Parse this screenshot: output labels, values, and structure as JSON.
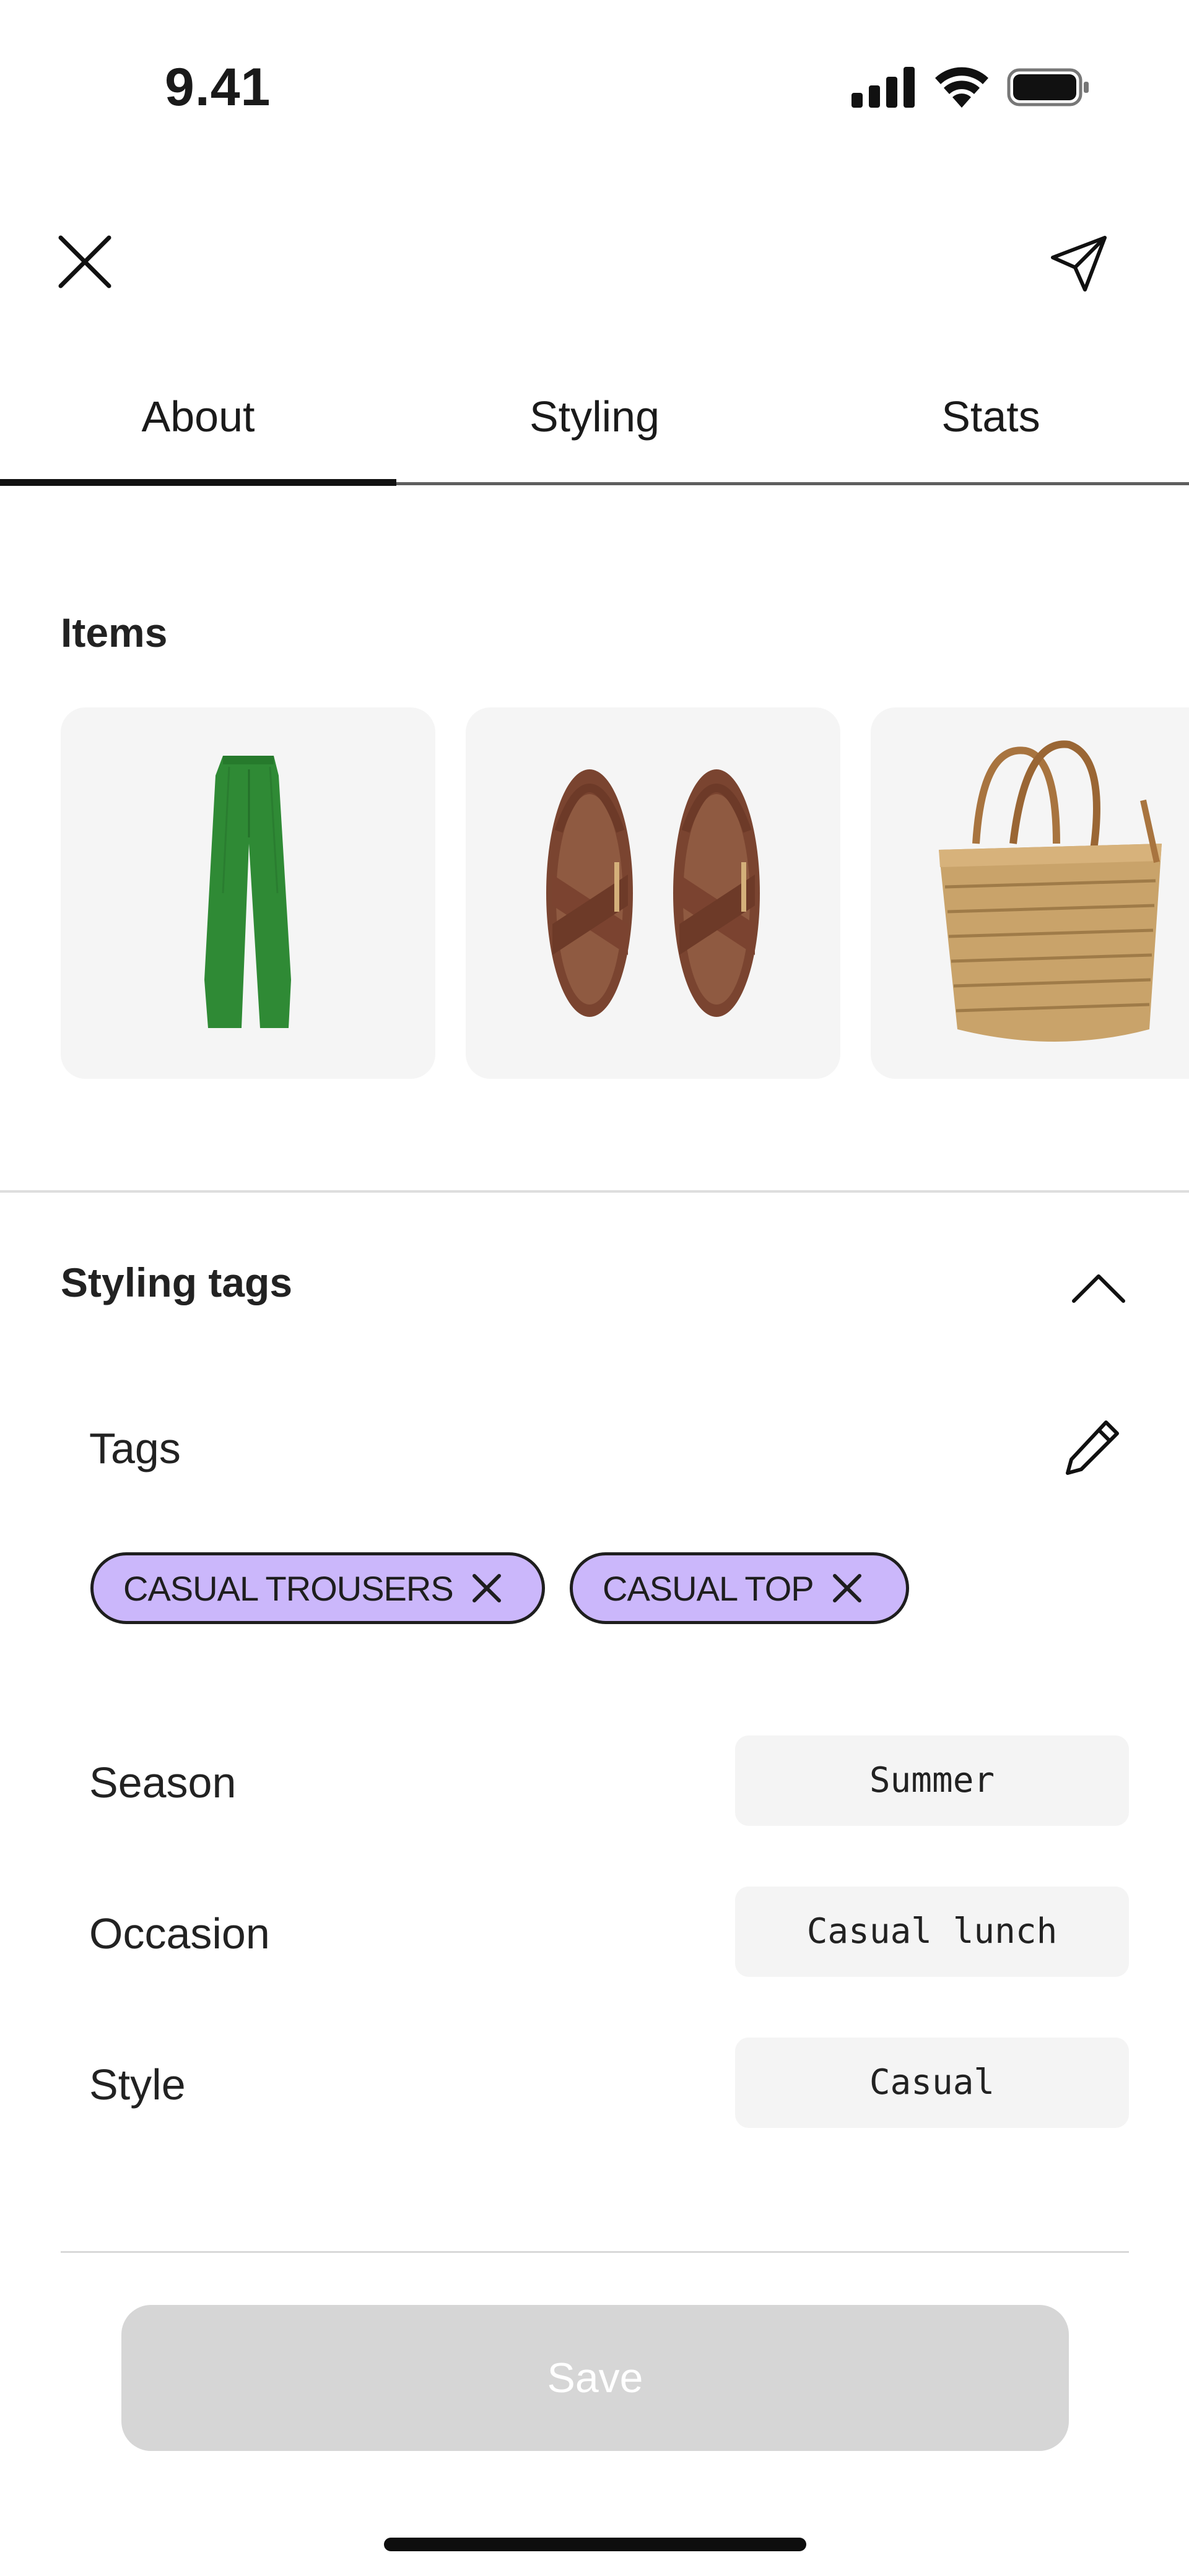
{
  "status_bar": {
    "time": "9.41",
    "icons": [
      "cellular-signal-icon",
      "wifi-icon",
      "battery-icon"
    ]
  },
  "header": {
    "close_icon": "close-icon",
    "share_icon": "send-icon"
  },
  "tabs": [
    {
      "label": "About",
      "selected": true
    },
    {
      "label": "Styling",
      "selected": false
    },
    {
      "label": "Stats",
      "selected": false
    }
  ],
  "items_section": {
    "title": "Items",
    "items": [
      {
        "image": "green-trousers"
      },
      {
        "image": "brown-sandals"
      },
      {
        "image": "woven-straw-bag"
      }
    ]
  },
  "styling_tags": {
    "title": "Styling tags",
    "expanded": true,
    "tags_label": "Tags",
    "tags": [
      "CASUAL TROUSERS",
      "CASUAL TOP"
    ],
    "fields": [
      {
        "label": "Season",
        "value": "Summer"
      },
      {
        "label": "Occasion",
        "value": "Casual lunch"
      },
      {
        "label": "Style",
        "value": "Casual"
      }
    ]
  },
  "save_button": {
    "label": "Save",
    "enabled": false
  },
  "colors": {
    "chip_fill": "#cbb7fb",
    "save_disabled": "#d6d6d6",
    "card_bg": "#f5f5f5"
  }
}
